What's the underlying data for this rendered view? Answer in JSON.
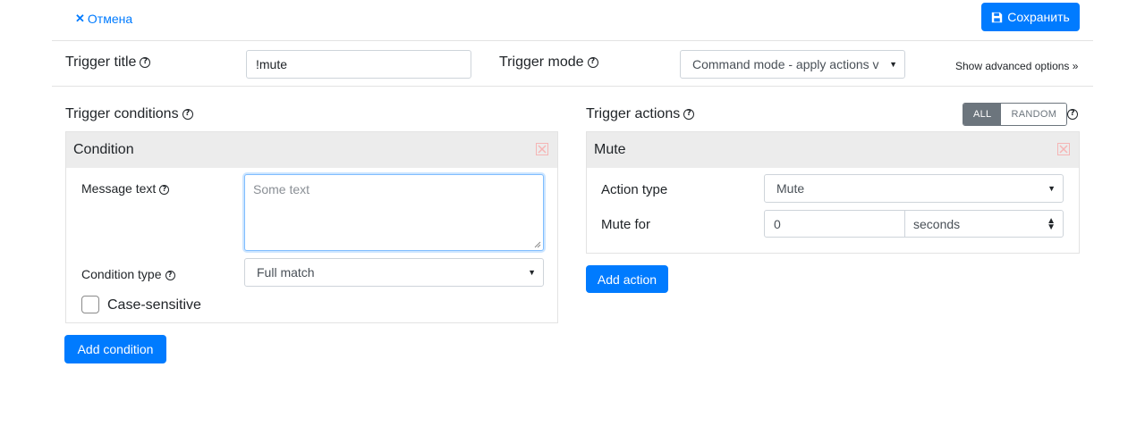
{
  "header": {
    "cancel_icon": "times-icon",
    "cancel_label": "Отмена",
    "save_icon": "save-icon",
    "save_label": "Сохранить"
  },
  "trigger": {
    "title_label": "Trigger title",
    "title_value": "!mute",
    "mode_label": "Trigger mode",
    "mode_value": "Command mode - apply actions v",
    "advanced_link": "Show advanced options »"
  },
  "conditions": {
    "section_label": "Trigger conditions",
    "panel_title": "Condition",
    "message_text_label": "Message text",
    "message_text_placeholder": "Some text",
    "message_text_value": "",
    "condition_type_label": "Condition type",
    "condition_type_value": "Full match",
    "case_sensitive_label": "Case-sensitive",
    "case_sensitive_checked": false,
    "add_button": "Add condition"
  },
  "actions": {
    "section_label": "Trigger actions",
    "mode_options": [
      "ALL",
      "RANDOM"
    ],
    "mode_selected": "ALL",
    "panel_title": "Mute",
    "action_type_label": "Action type",
    "action_type_value": "Mute",
    "mute_for_label": "Mute for",
    "mute_for_value": "0",
    "mute_unit_value": "seconds",
    "add_button": "Add action"
  },
  "colors": {
    "primary": "#007bff",
    "panel_header": "#ececec",
    "close_icon": "#f5b5b5",
    "focus_border": "#80bdff"
  }
}
